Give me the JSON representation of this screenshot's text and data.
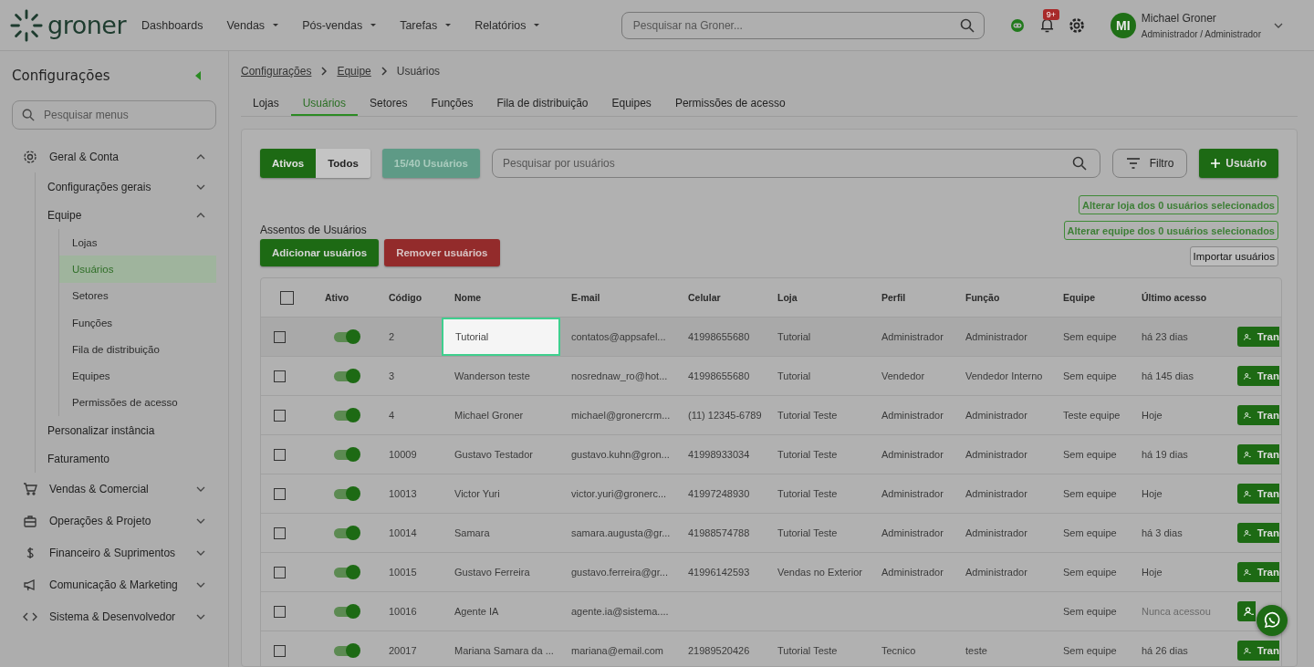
{
  "header": {
    "logo": "groner",
    "nav": [
      {
        "label": "Dashboards",
        "dropdown": false
      },
      {
        "label": "Vendas",
        "dropdown": true
      },
      {
        "label": "Pós-vendas",
        "dropdown": true
      },
      {
        "label": "Tarefas",
        "dropdown": true
      },
      {
        "label": "Relatórios",
        "dropdown": true
      }
    ],
    "search": {
      "placeholder": "Pesquisar na Groner..."
    },
    "notifications": "9+",
    "user": {
      "initials": "MI",
      "name": "Michael Groner",
      "role": "Administrador / Administrador"
    }
  },
  "sidebar": {
    "title": "Configurações",
    "search": {
      "placeholder": "Pesquisar menus"
    },
    "items": [
      {
        "label": "Geral & Conta",
        "expanded": true,
        "children": [
          {
            "label": "Configurações gerais",
            "expanded": false
          },
          {
            "label": "Equipe",
            "expanded": true,
            "children": [
              {
                "label": "Lojas",
                "selected": false
              },
              {
                "label": "Usuários",
                "selected": true
              },
              {
                "label": "Setores",
                "selected": false
              },
              {
                "label": "Funções",
                "selected": false
              },
              {
                "label": "Fila de distribuição",
                "selected": false
              },
              {
                "label": "Equipes",
                "selected": false
              },
              {
                "label": "Permissões de acesso",
                "selected": false
              }
            ]
          },
          {
            "label": "Personalizar instância"
          },
          {
            "label": "Faturamento"
          }
        ]
      },
      {
        "label": "Vendas & Comercial",
        "expanded": false
      },
      {
        "label": "Operações & Projeto",
        "expanded": false
      },
      {
        "label": "Financeiro & Suprimentos",
        "expanded": false
      },
      {
        "label": "Comunicação & Marketing",
        "expanded": false
      },
      {
        "label": "Sistema & Desenvolvedor",
        "expanded": false
      }
    ]
  },
  "breadcrumb": [
    "Configurações",
    "Equipe",
    "Usuários"
  ],
  "tabs": [
    {
      "label": "Lojas",
      "selected": false
    },
    {
      "label": "Usuários",
      "selected": true
    },
    {
      "label": "Setores",
      "selected": false
    },
    {
      "label": "Funções",
      "selected": false
    },
    {
      "label": "Fila de distribuição",
      "selected": false
    },
    {
      "label": "Equipes",
      "selected": false
    },
    {
      "label": "Permissões de acesso",
      "selected": false
    }
  ],
  "filters": [
    {
      "label": "Ativos",
      "selected": true
    },
    {
      "label": "Todos",
      "selected": false
    }
  ],
  "seats_count": "15/40 Usuários",
  "user_search": {
    "placeholder": "Pesquisar por usuários"
  },
  "filter_button": "Filtro",
  "add_user_button": "Usuário",
  "bulk_actions": [
    "Alterar loja dos 0 usuários selecionados",
    "Alterar equipe dos 0 usuários selecionados"
  ],
  "import_button": "Importar usuários",
  "seats": {
    "title": "Assentos de Usuários",
    "add": "Adicionar usuários",
    "remove": "Remover usuários"
  },
  "table": {
    "select_all": {
      "checked": false
    },
    "toggle_column": "Ativo",
    "columns": [
      "Código",
      "Nome",
      "E-mail",
      "Celular",
      "Loja",
      "Perfil",
      "Função",
      "Equipe",
      "Último acesso"
    ],
    "rows": [
      {
        "checked": false,
        "on": true,
        "spotlight": true,
        "cells": [
          "2",
          "Tutorial",
          "contatos@appsafel...",
          "41998655680",
          "Tutorial",
          "Administrador",
          "Administrador",
          "Sem equipe",
          "há 23 dias"
        ],
        "action": "Tran"
      },
      {
        "checked": false,
        "on": true,
        "spotlight": false,
        "cells": [
          "3",
          "Wanderson teste",
          "nosrednaw_ro@hot...",
          "41998655680",
          "Tutorial",
          "Vendedor",
          "Vendedor Interno",
          "Sem equipe",
          "há 145 dias"
        ],
        "action": "Tran"
      },
      {
        "checked": false,
        "on": true,
        "spotlight": false,
        "cells": [
          "4",
          "Michael Groner",
          "michael@gronercrm...",
          "(11) 12345-6789",
          "Tutorial Teste",
          "Administrador",
          "Administrador",
          "Teste equipe",
          "Hoje"
        ],
        "action": "Tran"
      },
      {
        "checked": false,
        "on": true,
        "spotlight": false,
        "cells": [
          "10009",
          "Gustavo Testador",
          "gustavo.kuhn@gron...",
          "41998933034",
          "Tutorial Teste",
          "Administrador",
          "Administrador",
          "Sem equipe",
          "há 19 dias"
        ],
        "action": "Tran"
      },
      {
        "checked": false,
        "on": true,
        "spotlight": false,
        "cells": [
          "10013",
          "Victor Yuri",
          "victor.yuri@gronerc...",
          "41997248930",
          "Tutorial Teste",
          "Administrador",
          "Administrador",
          "Sem equipe",
          "Hoje"
        ],
        "action": "Tran"
      },
      {
        "checked": false,
        "on": true,
        "spotlight": false,
        "cells": [
          "10014",
          "Samara",
          "samara.augusta@gr...",
          "41988574788",
          "Tutorial Teste",
          "Administrador",
          "Administrador",
          "Sem equipe",
          "há 3 dias"
        ],
        "action": "Tran"
      },
      {
        "checked": false,
        "on": true,
        "spotlight": false,
        "cells": [
          "10015",
          "Gustavo Ferreira",
          "gustavo.ferreira@gr...",
          "41996142593",
          "Vendas no Exterior",
          "Administrador",
          "Administrador",
          "Sem equipe",
          "Hoje"
        ],
        "action": "Tran"
      },
      {
        "checked": false,
        "on": true,
        "spotlight": false,
        "never": true,
        "cells": [
          "10016",
          "Agente IA",
          "agente.ia@sistema....",
          "",
          "",
          "",
          "",
          "Sem equipe",
          "Nunca acessou"
        ]
      },
      {
        "checked": false,
        "on": true,
        "spotlight": false,
        "cells": [
          "20017",
          "Mariana Samara da ...",
          "mariana@email.com",
          "21989520426",
          "Tutorial Teste",
          "Tecnico",
          "teste",
          "Sem equipe",
          "há 26 dias"
        ],
        "action": "Tran"
      }
    ]
  }
}
